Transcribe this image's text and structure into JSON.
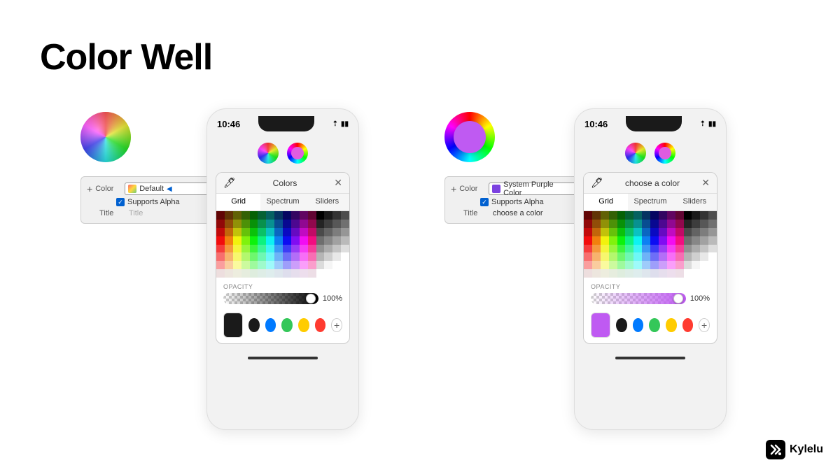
{
  "page": {
    "title": "Color Well",
    "background": "#ffffff"
  },
  "branding": {
    "name": "Kylelu"
  },
  "left_section": {
    "inspector": {
      "label_color": "Color",
      "label_supports": "Supports Alpha",
      "label_title": "Title",
      "value_default": "Default",
      "value_title_placeholder": "Title",
      "plus_icon": "+"
    }
  },
  "right_section": {
    "inspector": {
      "label_color": "Color",
      "label_supports": "Supports Alpha",
      "label_title": "Title",
      "value_color": "System Purple Color",
      "value_title": "choose a color",
      "plus_icon": "+"
    }
  },
  "left_phone": {
    "time": "10:46",
    "picker_title": "Colors",
    "tabs": [
      "Grid",
      "Spectrum",
      "Sliders"
    ],
    "active_tab": "Grid",
    "opacity_label": "OPACITY",
    "opacity_value": "100%",
    "close_icon": "✕",
    "plus_icon": "+",
    "add_label": "+"
  },
  "right_phone": {
    "time": "10:46",
    "picker_title": "choose a color",
    "tabs": [
      "Grid",
      "Spectrum",
      "Sliders"
    ],
    "active_tab": "Grid",
    "opacity_label": "OPACITY",
    "opacity_value": "100%",
    "close_icon": "✕",
    "plus_icon": "+",
    "add_label": "+"
  }
}
